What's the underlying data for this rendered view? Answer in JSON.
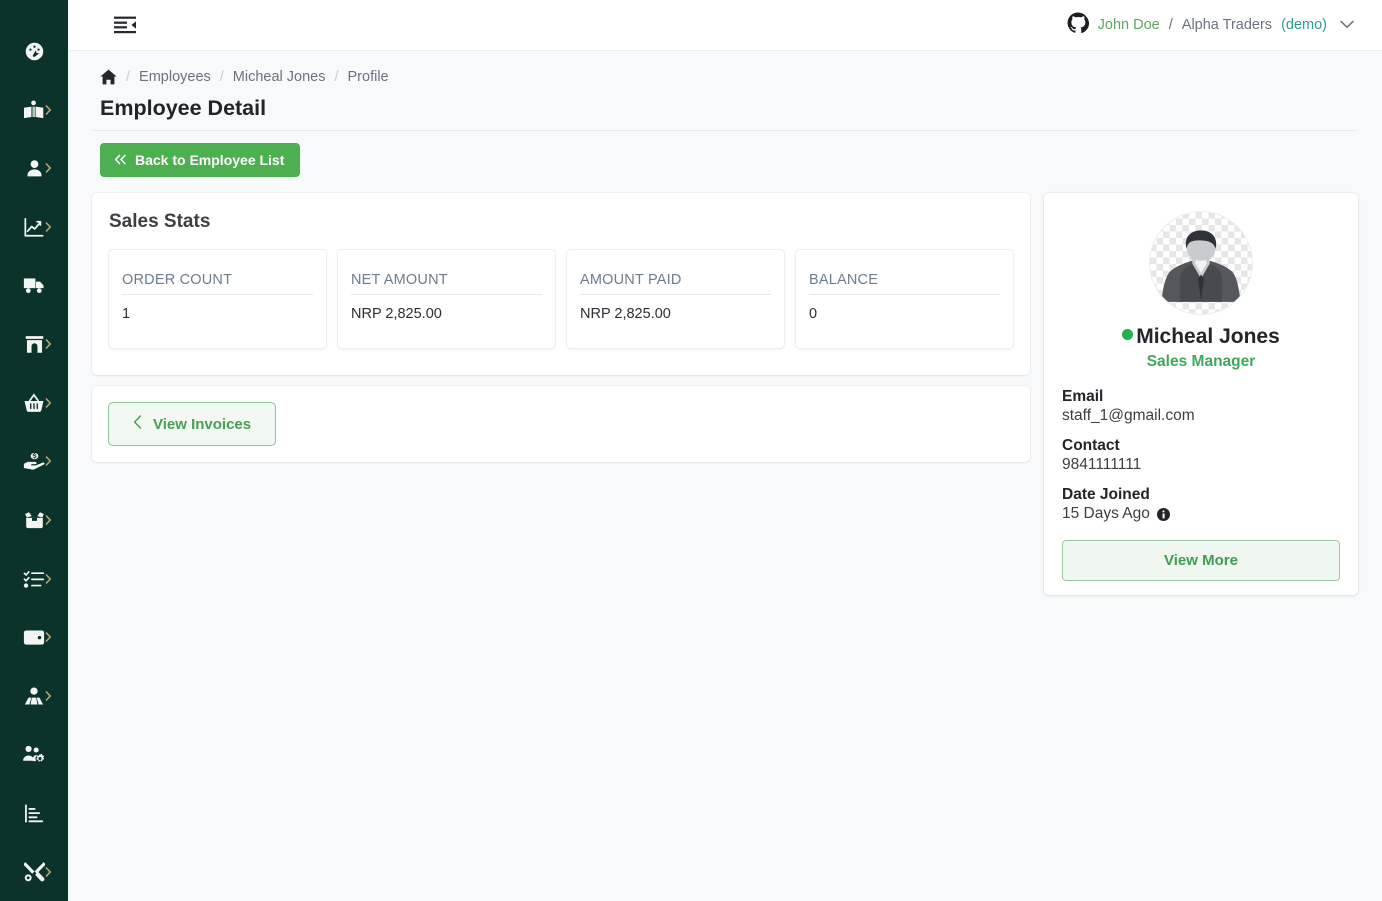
{
  "sidebar": {
    "items": [
      {
        "name": "dashboard",
        "icon": "gauge-icon",
        "has_submenu": false
      },
      {
        "name": "catalog",
        "icon": "open-book-icon",
        "has_submenu": true
      },
      {
        "name": "customers",
        "icon": "user-icon",
        "has_submenu": true
      },
      {
        "name": "reports",
        "icon": "line-chart-icon",
        "has_submenu": true
      },
      {
        "name": "shipping",
        "icon": "truck-icon",
        "has_submenu": false
      },
      {
        "name": "store",
        "icon": "storefront-icon",
        "has_submenu": true
      },
      {
        "name": "orders",
        "icon": "basket-icon",
        "has_submenu": true
      },
      {
        "name": "payments",
        "icon": "hand-money-icon",
        "has_submenu": true
      },
      {
        "name": "inventory",
        "icon": "box-open-icon",
        "has_submenu": true
      },
      {
        "name": "tasks",
        "icon": "checklist-icon",
        "has_submenu": true
      },
      {
        "name": "wallet",
        "icon": "wallet-icon",
        "has_submenu": true
      },
      {
        "name": "employees",
        "icon": "user-group-icon",
        "has_submenu": true
      },
      {
        "name": "user-settings",
        "icon": "users-cog-icon",
        "has_submenu": false
      },
      {
        "name": "analytics",
        "icon": "bar-chart-icon",
        "has_submenu": false
      },
      {
        "name": "tools",
        "icon": "tools-icon",
        "has_submenu": true
      }
    ]
  },
  "topbar": {
    "fold_icon": "menu-fold-icon",
    "account_icon": "github-icon",
    "user_name": "John Doe",
    "separator": "/",
    "org_name": "Alpha Traders",
    "org_mode": "(demo)",
    "caret_icon": "chevron-down-icon"
  },
  "breadcrumb": {
    "home_icon": "home-icon",
    "sep": "/",
    "items": [
      {
        "label": "Employees"
      },
      {
        "label": "Micheal Jones"
      },
      {
        "label": "Profile"
      }
    ]
  },
  "page": {
    "title": "Employee Detail",
    "back_button": "Back to Employee List",
    "back_icon": "double-chevron-left-icon"
  },
  "stats": {
    "heading": "Sales Stats",
    "cards": [
      {
        "label": "ORDER COUNT",
        "value": "1"
      },
      {
        "label": "NET AMOUNT",
        "value": "NRP 2,825.00"
      },
      {
        "label": "AMOUNT PAID",
        "value": "NRP 2,825.00"
      },
      {
        "label": "BALANCE",
        "value": "0"
      }
    ]
  },
  "invoices": {
    "button_label": "View Invoices",
    "button_icon": "chevron-left-icon"
  },
  "profile": {
    "avatar_icon": "default-user-photo",
    "status": "online",
    "name": "Micheal Jones",
    "role": "Sales Manager",
    "fields": [
      {
        "label": "Email",
        "value": "staff_1@gmail.com"
      },
      {
        "label": "Contact",
        "value": "9841111111"
      },
      {
        "label": "Date Joined",
        "value": "15 Days Ago",
        "info_icon": "info-circle-icon"
      }
    ],
    "view_more_label": "View More"
  },
  "colors": {
    "sidebar_bg": "#0c332b",
    "page_bg": "#f8f9fa",
    "primary_green": "#4caf50",
    "accent_green": "#3fa95b",
    "status_dot": "#22b14c",
    "demo_teal": "#2a9d8f",
    "user_green": "#5fa662"
  }
}
